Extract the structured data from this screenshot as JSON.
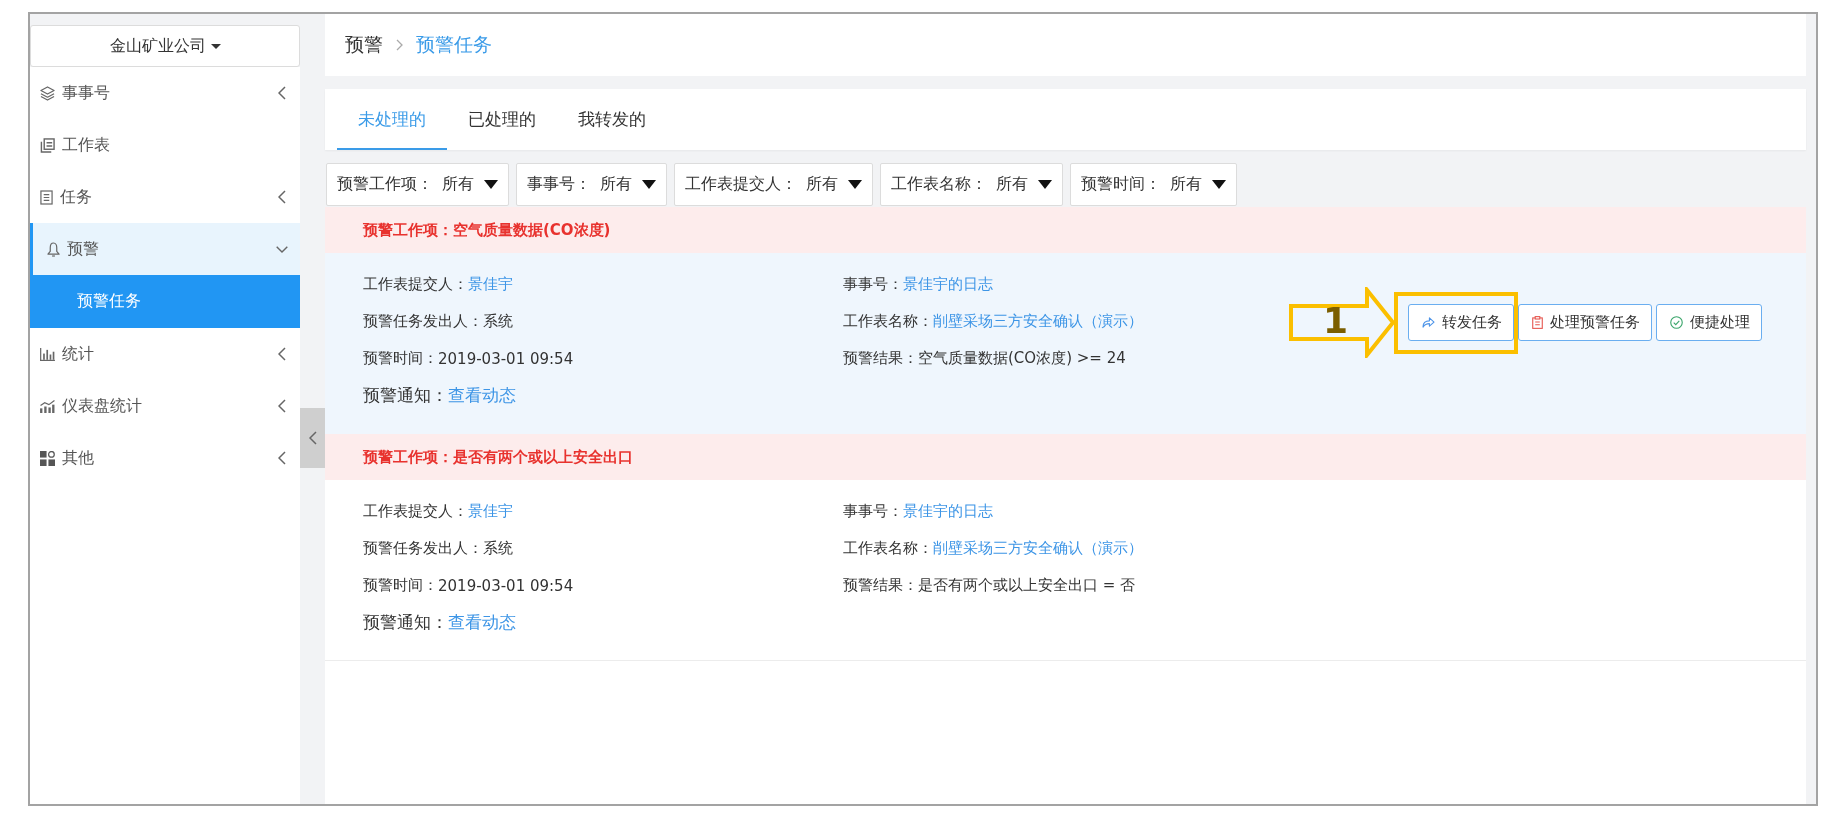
{
  "sidebar": {
    "company": "金山矿业公司",
    "items": [
      {
        "label": "事事号",
        "expanded": false,
        "selected": false
      },
      {
        "label": "工作表",
        "selected": false
      },
      {
        "label": "任务",
        "expanded": false,
        "selected": false
      },
      {
        "label": "预警",
        "expanded": true,
        "selected": true,
        "children": [
          {
            "label": "预警任务",
            "selected": true
          }
        ]
      },
      {
        "label": "统计",
        "expanded": false,
        "selected": false
      },
      {
        "label": "仪表盘统计",
        "expanded": false,
        "selected": false
      },
      {
        "label": "其他",
        "expanded": false,
        "selected": false
      }
    ]
  },
  "breadcrumb": [
    "预警",
    "预警任务"
  ],
  "tabs": [
    {
      "label": "未处理的",
      "selected": true
    },
    {
      "label": "已处理的",
      "selected": false
    },
    {
      "label": "我转发的",
      "selected": false
    }
  ],
  "filters": [
    {
      "label": "预警工作项：",
      "value": "所有"
    },
    {
      "label": "事事号：",
      "value": "所有"
    },
    {
      "label": "工作表提交人：",
      "value": "所有"
    },
    {
      "label": "工作表名称：",
      "value": "所有"
    },
    {
      "label": "预警时间：",
      "value": "所有"
    }
  ],
  "alerts": [
    {
      "title": "预警工作项：空气质量数据(CO浓度)",
      "selected": true,
      "fields": [
        {
          "label": "工作表提交人：",
          "value": "景佳宇",
          "kind": "link"
        },
        {
          "label": "事事号：",
          "value": "景佳宇的日志",
          "kind": "link"
        },
        {
          "label": "预警任务发出人：",
          "value": "系统",
          "kind": "text"
        },
        {
          "label": "工作表名称：",
          "value": "削壁采场三方安全确认（演示）",
          "kind": "link"
        },
        {
          "label": "预警时间：",
          "value": "2019-03-01 09:54",
          "kind": "text"
        },
        {
          "label": "预警结果：",
          "value": "空气质量数据(CO浓度) >= 24",
          "kind": "text"
        }
      ],
      "notice": {
        "label": "预警通知：",
        "link": "查看动态"
      },
      "actions": [
        {
          "label": "转发任务",
          "highlighted": true,
          "callout": "1"
        },
        {
          "label": "处理预警任务",
          "highlighted": false
        },
        {
          "label": "便捷处理",
          "highlighted": false
        }
      ]
    },
    {
      "title": "预警工作项：是否有两个或以上安全出口",
      "selected": false,
      "fields": [
        {
          "label": "工作表提交人：",
          "value": "景佳宇",
          "kind": "link"
        },
        {
          "label": "事事号：",
          "value": "景佳宇的日志",
          "kind": "link"
        },
        {
          "label": "预警任务发出人：",
          "value": "系统",
          "kind": "text"
        },
        {
          "label": "工作表名称：",
          "value": "削壁采场三方安全确认（演示）",
          "kind": "link"
        },
        {
          "label": "预警时间：",
          "value": "2019-03-01 09:54",
          "kind": "text"
        },
        {
          "label": "预警结果：",
          "value": "是否有两个或以上安全出口 = 否",
          "kind": "text"
        }
      ],
      "notice": {
        "label": "预警通知：",
        "link": "查看动态"
      }
    }
  ]
}
